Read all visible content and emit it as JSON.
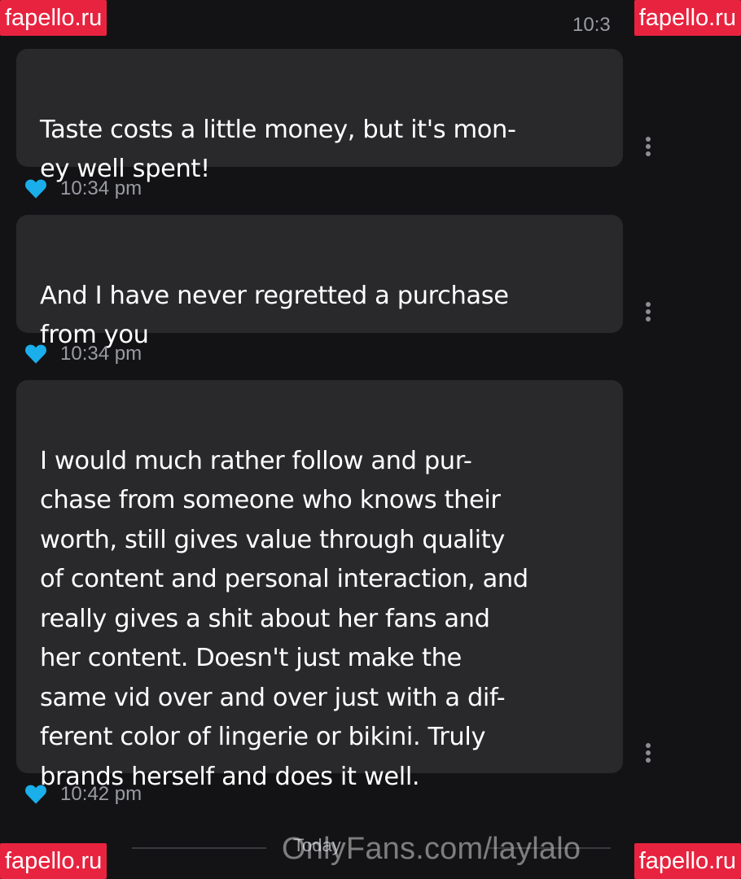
{
  "header": {
    "time_partial": "10:3"
  },
  "messages": [
    {
      "text": "Taste costs a little money, but it's mon-\ney well spent!",
      "liked": true,
      "time": "10:34 pm"
    },
    {
      "text": "And I have never regretted a purchase\nfrom you",
      "liked": true,
      "time": "10:34 pm"
    },
    {
      "text": "I would much rather follow and pur-\nchase from someone who knows their\nworth, still gives value through quality\nof content and personal interaction, and\nreally gives a shit about her fans and\nher content. Doesn't just make the\nsame vid over and over just with a dif-\nferent color of lingerie or bikini. Truly\nbrands herself and does it well.",
      "liked": true,
      "time": "10:42 pm"
    }
  ],
  "day_divider": {
    "label": "Today"
  },
  "watermarks": {
    "corner_text": "fapello.ru",
    "center_text": "OnlyFans.com/laylalo"
  },
  "colors": {
    "background": "#131315",
    "bubble": "#29292c",
    "heart": "#1aaeea",
    "time_text": "#9a9ca2",
    "watermark_badge": "#e8233f"
  },
  "icons": {
    "like": "heart-icon",
    "menu": "more-vertical-icon"
  }
}
